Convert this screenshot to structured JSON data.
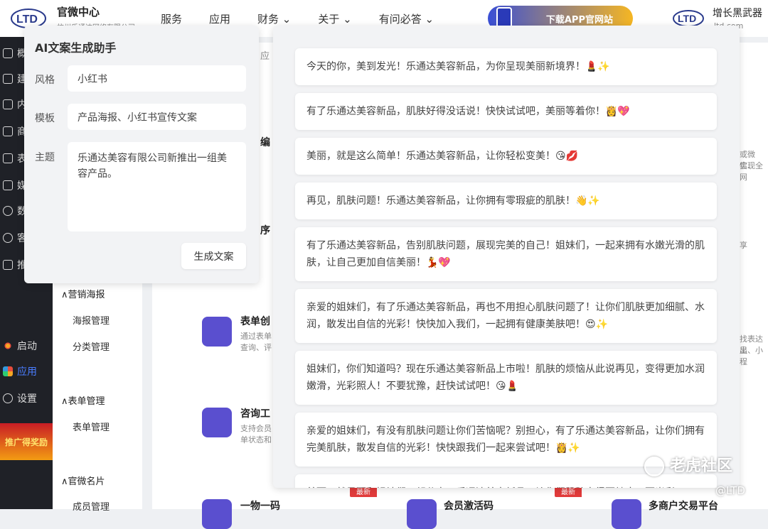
{
  "topbar": {
    "brand": "官微中心",
    "brand_sub": "杭州乐通达网络有限公司",
    "nav": [
      "服务",
      "应用",
      "财务 ⌄",
      "关于 ⌄",
      "有问必答 ⌄"
    ],
    "banner": "下载APP官网站",
    "brand2": "增长黑武器",
    "brand2_sub": "ltd.com"
  },
  "sidebar": {
    "items": [
      "概",
      "建",
      "内",
      "商",
      "表",
      "媒",
      "数",
      "客",
      "推"
    ],
    "bottom": [
      {
        "label": "启动",
        "icon": "launch-icon"
      },
      {
        "label": "应用",
        "icon": "apps-icon"
      },
      {
        "label": "设置",
        "icon": "gear-icon"
      }
    ],
    "promo": "推广得奖励"
  },
  "subnav": {
    "groups": [
      {
        "title": "∧营销海报",
        "items": [
          "海报管理",
          "分类管理"
        ]
      },
      {
        "title": "∧表单管理",
        "items": [
          "表单管理"
        ]
      },
      {
        "title": "∧官微名片",
        "items": [
          "成员管理"
        ]
      }
    ]
  },
  "content": {
    "cards": [
      {
        "title": "表单创",
        "desc": "通过表单\n查询、评"
      },
      {
        "title": "咨询工",
        "desc": "支持会员\n单状态和"
      },
      {
        "title": "一物一码",
        "desc": ""
      },
      {
        "title": "会员激活码",
        "desc": ""
      },
      {
        "title": "多商户交易平台",
        "desc": ""
      }
    ],
    "badges": [
      "最新",
      "最新"
    ],
    "fragments": [
      "编",
      "序",
      "应",
      "或微信、",
      "实现全网",
      "享",
      "找表达显",
      "出、小程"
    ]
  },
  "generator": {
    "title": "AI文案生成助手",
    "style_label": "风格",
    "style_value": "小红书",
    "template_label": "模板",
    "template_value": "产品海报、小红书宣传文案",
    "topic_label": "主题",
    "topic_value": "乐通达美容有限公司新推出一组美容产品。",
    "button": "生成文案"
  },
  "results": [
    "今天的你，美到发光！乐通达美容新品，为你呈现美丽新境界！💄✨",
    "有了乐通达美容新品，肌肤好得没话说！快快试试吧，美丽等着你！👸💖",
    "美丽，就是这么简单！乐通达美容新品，让你轻松变美！😘💋",
    "再见，肌肤问题！乐通达美容新品，让你拥有零瑕疵的肌肤！👋✨",
    "有了乐通达美容新品，告别肌肤问题，展现完美的自己！姐妹们，一起来拥有水嫩光滑的肌肤，让自己更加自信美丽！💃💖",
    "亲爱的姐妹们，有了乐通达美容新品，再也不用担心肌肤问题了！让你们肌肤更加细腻、水润，散发出自信的光彩！快快加入我们，一起拥有健康美肤吧！😍✨",
    "姐妹们，你们知道吗？现在乐通达美容新品上市啦！肌肤的烦恼从此说再见，变得更加水润嫩滑，光彩照人！不要犹豫，赶快试试吧！😘💄",
    "亲爱的姐妹们，有没有肌肤问题让你们苦恼呢？别担心，有了乐通达美容新品，让你们拥有完美肌肤，散发自信的光彩！快快跟我们一起来尝试吧！👸✨",
    "美丽，就是要和姐妹们一起分享！乐通达美容新品，让你们肌肤变得更健康、更光彩"
  ],
  "watermark": {
    "main": "老虎社区",
    "sub": "@LTD"
  }
}
